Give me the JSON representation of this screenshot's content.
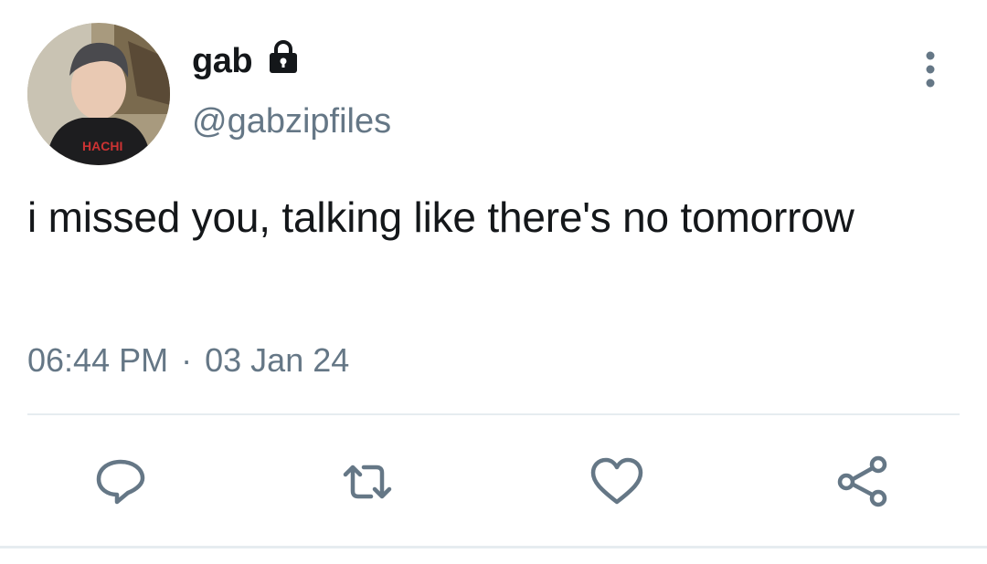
{
  "tweet": {
    "display_name": "gab",
    "username": "@gabzipfiles",
    "protected": true,
    "text": "i missed you, talking like there's no tomorrow",
    "time": "06:44 PM",
    "separator": "·",
    "date": "03 Jan 24"
  },
  "icons": {
    "lock": "lock-icon",
    "more": "more-vertical-icon",
    "reply": "reply-icon",
    "retweet": "retweet-icon",
    "like": "heart-icon",
    "share": "share-icon"
  },
  "colors": {
    "text_primary": "#14171a",
    "text_secondary": "#657786",
    "icon": "#657786",
    "divider": "#e6ecf0"
  }
}
